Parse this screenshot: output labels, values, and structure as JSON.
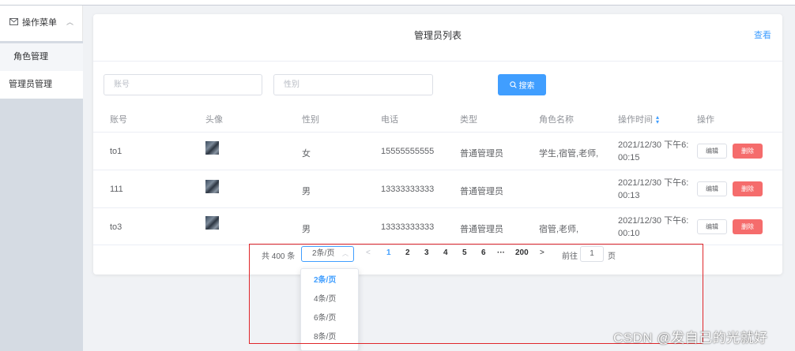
{
  "sidebar": {
    "menu_title": "操作菜单",
    "items": [
      {
        "label": "角色管理"
      },
      {
        "label": "管理员管理"
      }
    ]
  },
  "card": {
    "title": "管理员列表",
    "view_link": "查看"
  },
  "search": {
    "account_placeholder": "账号",
    "sex_placeholder": "性别",
    "button_label": "搜索"
  },
  "table": {
    "headers": [
      "账号",
      "头像",
      "性别",
      "电话",
      "类型",
      "角色名称",
      "操作时间",
      "操作"
    ],
    "rows": [
      {
        "account": "to1",
        "sex": "女",
        "phone": "15555555555",
        "type": "普通管理员",
        "roles": "学生,宿管,老师,",
        "time_line1": "2021/12/30 下午6:",
        "time_line2": "00:15"
      },
      {
        "account": "111",
        "sex": "男",
        "phone": "13333333333",
        "type": "普通管理员",
        "roles": "",
        "time_line1": "2021/12/30 下午6:",
        "time_line2": "00:13"
      },
      {
        "account": "to3",
        "sex": "男",
        "phone": "13333333333",
        "type": "普通管理员",
        "roles": "宿管,老师,",
        "time_line1": "2021/12/30 下午6:",
        "time_line2": "00:10"
      }
    ],
    "edit_label": "编辑",
    "delete_label": "删除"
  },
  "pagination": {
    "total": "共 400 条",
    "page_size": "2条/页",
    "pages": [
      "1",
      "2",
      "3",
      "4",
      "5",
      "6",
      "···",
      "200"
    ],
    "active_page": "1",
    "goto_label": "前往",
    "goto_value": "1",
    "page_unit": "页",
    "size_options": [
      "2条/页",
      "4条/页",
      "6条/页",
      "8条/页"
    ]
  },
  "watermark": "CSDN @发自己的光就好",
  "colors": {
    "primary": "#409eff",
    "danger": "#f56c6c",
    "highlight_box": "#e0262a"
  }
}
